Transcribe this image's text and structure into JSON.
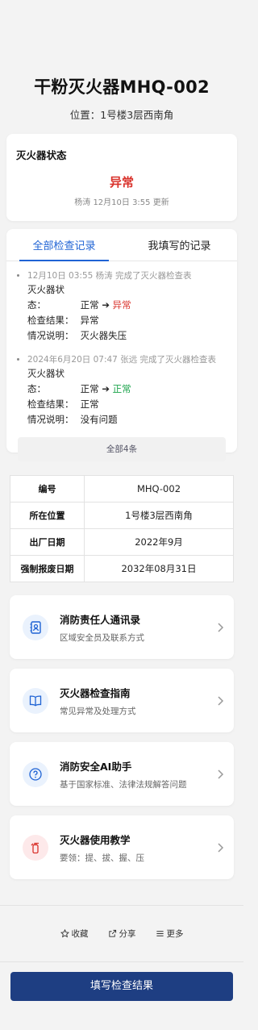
{
  "header": {
    "title": "干粉灭火器MHQ-002",
    "location": "位置：1号楼3层西南角"
  },
  "status": {
    "heading": "灭火器状态",
    "value": "异常",
    "meta": "杨涛 12月10日 3:55 更新"
  },
  "records": {
    "tabs": [
      "全部检查记录",
      "我填写的记录"
    ],
    "active_tab": 0,
    "items": [
      {
        "head": "12月10日 03:55  杨涛  完成了灭火器检查表",
        "status_label": "灭火器状态：",
        "status_from": "正常",
        "status_to": "异常",
        "result_label": "检查结果：",
        "result": "异常",
        "note_label": "情况说明：",
        "note": "灭火器失压"
      },
      {
        "head": "2024年6月20日 07:47  张远  完成了灭火器检查表",
        "status_label": "灭火器状态：",
        "status_from": "正常",
        "status_to": "正常",
        "result_label": "检查结果：",
        "result": "正常",
        "note_label": "情况说明：",
        "note": "没有问题"
      }
    ],
    "all_button": "全部4条"
  },
  "info": [
    {
      "key": "编号",
      "value": "MHQ-002"
    },
    {
      "key": "所在位置",
      "value": "1号楼3层西南角"
    },
    {
      "key": "出厂日期",
      "value": "2022年9月"
    },
    {
      "key": "强制报废日期",
      "value": "2032年08月31日"
    }
  ],
  "links": [
    {
      "title": "消防责任人通讯录",
      "subtitle": "区域安全员及联系方式",
      "icon": "contact-book-icon"
    },
    {
      "title": "灭火器检查指南",
      "subtitle": "常见异常及处理方式",
      "icon": "book-icon"
    },
    {
      "title": "消防安全AI助手",
      "subtitle": "基于国家标准、法律法规解答问题",
      "icon": "question-icon"
    },
    {
      "title": "灭火器使用教学",
      "subtitle": "要领：提、拔、握、压",
      "icon": "extinguisher-icon"
    }
  ],
  "actions": {
    "favorite": "收藏",
    "share": "分享",
    "more": "更多"
  },
  "primary_button": "填写检查结果",
  "colors": {
    "accent": "#1f63d4",
    "abnormal": "#d9322b",
    "normal": "#1aa34a",
    "primary": "#1e3e82"
  }
}
